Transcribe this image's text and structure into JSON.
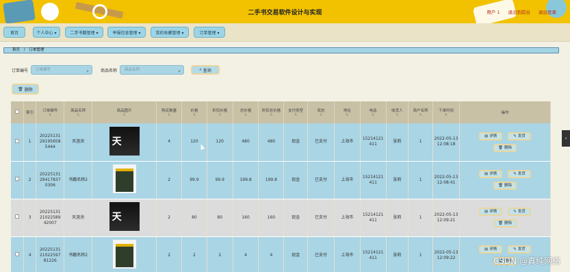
{
  "header": {
    "title": "二手书交易软件设计与实现",
    "user": "用户 1",
    "back_admin": "退出到前台",
    "logout": "退出登录"
  },
  "nav": {
    "items": [
      {
        "label": "首页"
      },
      {
        "label": "个人中心 ▾"
      },
      {
        "label": "二手书籍管理 ▾"
      },
      {
        "label": "举报信息管理 ▾"
      },
      {
        "label": "我的收藏管理 ▾"
      },
      {
        "label": "订单管理 ▾"
      }
    ]
  },
  "breadcrumb": {
    "home": "首页",
    "sep": "/",
    "current": "订单管理"
  },
  "search": {
    "order_label": "订单编号",
    "order_placeholder": "订单编号",
    "name_label": "商品名称",
    "name_placeholder": "商品名称",
    "query_label": "查询"
  },
  "actions": {
    "delete_label": "删除"
  },
  "table": {
    "headers": [
      "索引",
      "订单编号",
      "商品名称",
      "商品图片",
      "购买数量",
      "价格",
      "折扣价格",
      "总价格",
      "折扣总价格",
      "支付类型",
      "状态",
      "地址",
      "电话",
      "收货人",
      "商户名称",
      "下单时间",
      "操作"
    ],
    "rows": [
      {
        "idx": "1",
        "order": "20225131 29195658 5444",
        "name": "天涯泱",
        "qty": "4",
        "price": "120",
        "dprice": "120",
        "total": "480",
        "dtotal": "480",
        "pay": "现金",
        "status": "已支付",
        "addr": "上海市",
        "phone": "15214121 411",
        "consignee": "张莉",
        "merchant": "1",
        "time": "2022-05-13 12:08:18"
      },
      {
        "idx": "2",
        "order": "20225131 29417837 0306",
        "name": "书籍名称2",
        "qty": "2",
        "price": "99.9",
        "dprice": "99.9",
        "total": "199.8",
        "dtotal": "199.8",
        "pay": "现金",
        "status": "已支付",
        "addr": "上海市",
        "phone": "15214121 411",
        "consignee": "张莉",
        "merchant": "1",
        "time": "2022-05-13 12:08:41"
      },
      {
        "idx": "3",
        "order": "20225131 21022589 42007",
        "name": "天涯泱",
        "qty": "2",
        "price": "80",
        "dprice": "80",
        "total": "160",
        "dtotal": "160",
        "pay": "现金",
        "status": "已支付",
        "addr": "上海市",
        "phone": "15214121 411",
        "consignee": "张莉",
        "merchant": "1",
        "time": "2022-05-13 12:09:21"
      },
      {
        "idx": "4",
        "order": "20225131 21022597 81226",
        "name": "书籍名称2",
        "qty": "2",
        "price": "2",
        "dprice": "2",
        "total": "4",
        "dtotal": "4",
        "pay": "现金",
        "status": "已支付",
        "addr": "上海市",
        "phone": "15214121 411",
        "consignee": "张莉",
        "merchant": "1",
        "time": "2022-05-13 12:09:22"
      }
    ],
    "op_detail": "详情",
    "op_ship": "发货",
    "op_delete": "删除"
  },
  "watermark": "CSDN @真纯网络",
  "icons": [
    "search-icon",
    "delete-icon",
    "detail-icon",
    "edit-icon",
    "sort-icon",
    "collapse-handle-icon"
  ]
}
